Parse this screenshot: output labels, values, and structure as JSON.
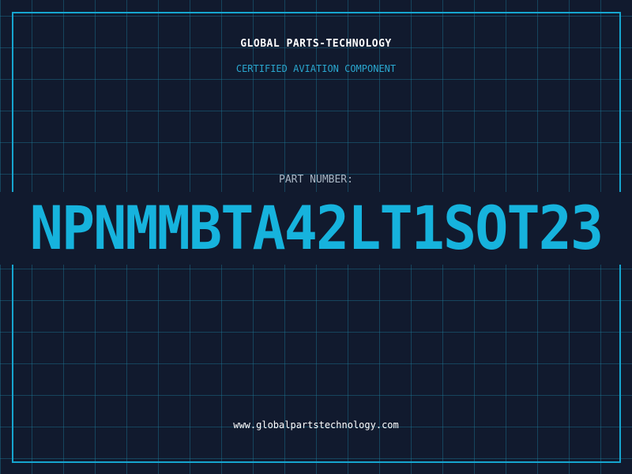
{
  "header": {
    "brand": "GLOBAL PARTS-TECHNOLOGY",
    "tagline": "CERTIFIED AVIATION COMPONENT"
  },
  "part": {
    "label": "PART NUMBER:",
    "number": "NPNMMBTA42LT1SOT23"
  },
  "footer": {
    "website": "www.globalpartstechnology.com"
  },
  "colors": {
    "background": "#111a2e",
    "accent": "#16b3dd",
    "frame": "#16a5cf",
    "grid": "#1e7896"
  }
}
